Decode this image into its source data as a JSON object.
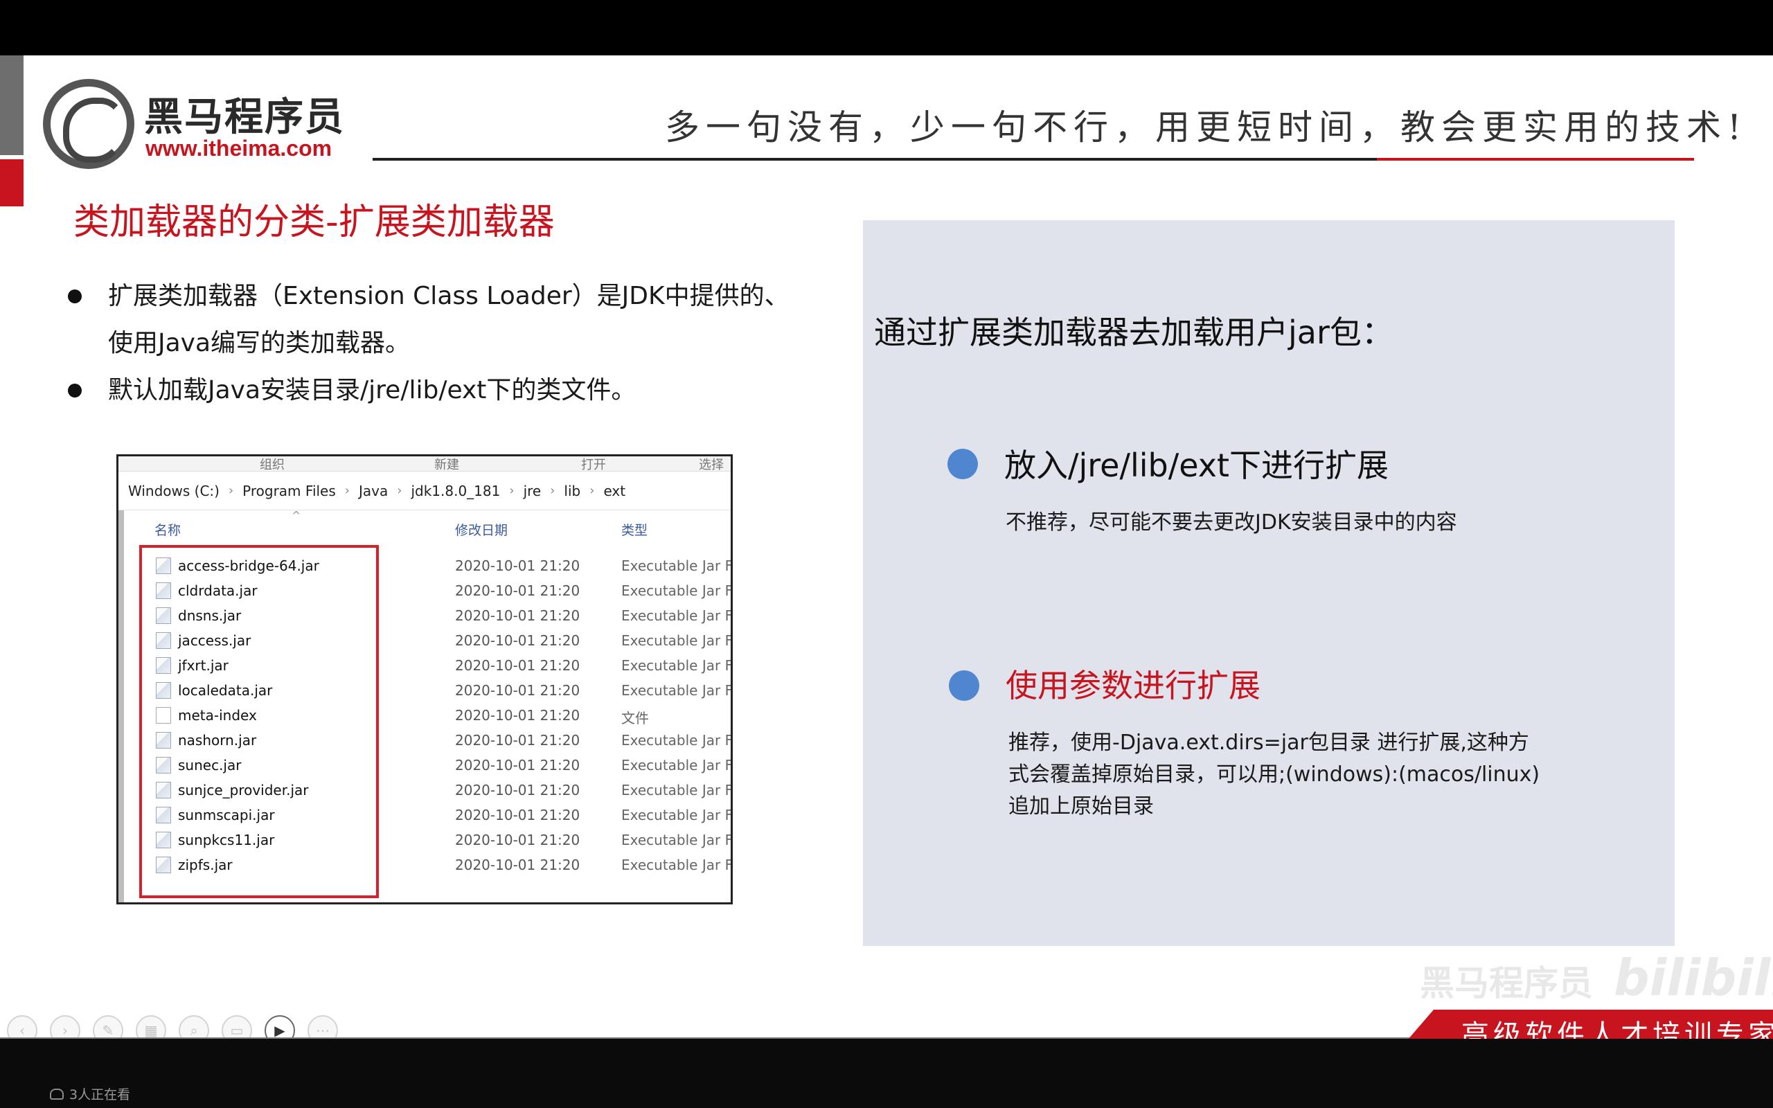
{
  "logo": {
    "name": "黑马程序员",
    "url": "www.itheima.com"
  },
  "slogan": "多一句没有，少一句不行，用更短时间，教会更实用的技术!",
  "slide_title": "类加载器的分类-扩展类加载器",
  "bullets": [
    {
      "line1": "扩展类加载器（Extension Class Loader）是JDK中提供的、",
      "line2": "使用Java编写的类加载器。"
    },
    {
      "line1": "默认加载Java安装目录/jre/lib/ext下的类文件。"
    }
  ],
  "explorer": {
    "ribbon": [
      "组织",
      "新建",
      "打开",
      "选择"
    ],
    "breadcrumb": [
      "Windows (C:)",
      "Program Files",
      "Java",
      "jdk1.8.0_181",
      "jre",
      "lib",
      "ext"
    ],
    "columns": {
      "name": "名称",
      "date": "修改日期",
      "type": "类型"
    },
    "files": [
      {
        "name": "access-bridge-64.jar",
        "date": "2020-10-01 21:20",
        "type": "Executable Jar Fi",
        "icon": "jar-file-icon"
      },
      {
        "name": "cldrdata.jar",
        "date": "2020-10-01 21:20",
        "type": "Executable Jar Fi",
        "icon": "jar-file-icon"
      },
      {
        "name": "dnsns.jar",
        "date": "2020-10-01 21:20",
        "type": "Executable Jar Fi",
        "icon": "jar-file-icon"
      },
      {
        "name": "jaccess.jar",
        "date": "2020-10-01 21:20",
        "type": "Executable Jar Fi",
        "icon": "jar-file-icon"
      },
      {
        "name": "jfxrt.jar",
        "date": "2020-10-01 21:20",
        "type": "Executable Jar Fi",
        "icon": "jar-file-icon"
      },
      {
        "name": "localedata.jar",
        "date": "2020-10-01 21:20",
        "type": "Executable Jar Fi",
        "icon": "jar-file-icon"
      },
      {
        "name": "meta-index",
        "date": "2020-10-01 21:20",
        "type": "文件",
        "icon": "file-icon"
      },
      {
        "name": "nashorn.jar",
        "date": "2020-10-01 21:20",
        "type": "Executable Jar Fi",
        "icon": "jar-file-icon"
      },
      {
        "name": "sunec.jar",
        "date": "2020-10-01 21:20",
        "type": "Executable Jar Fi",
        "icon": "jar-file-icon"
      },
      {
        "name": "sunjce_provider.jar",
        "date": "2020-10-01 21:20",
        "type": "Executable Jar Fi",
        "icon": "jar-file-icon"
      },
      {
        "name": "sunmscapi.jar",
        "date": "2020-10-01 21:20",
        "type": "Executable Jar Fi",
        "icon": "jar-file-icon"
      },
      {
        "name": "sunpkcs11.jar",
        "date": "2020-10-01 21:20",
        "type": "Executable Jar Fi",
        "icon": "jar-file-icon"
      },
      {
        "name": "zipfs.jar",
        "date": "2020-10-01 21:20",
        "type": "Executable Jar Fi",
        "icon": "jar-file-icon"
      }
    ]
  },
  "panel": {
    "heading": "通过扩展类加载器去加载用户jar包：",
    "option1": {
      "title": "放入/jre/lib/ext下进行扩展",
      "desc": "不推荐，尽可能不要去更改JDK安装目录中的内容"
    },
    "option2": {
      "title": "使用参数进行扩展",
      "desc_lines": [
        "推荐，使用-Djava.ext.dirs=jar包目录 进行扩展,这种方",
        "式会覆盖掉原始目录，可以用;(windows):(macos/linux)",
        "追加上原始目录"
      ]
    }
  },
  "watermark": {
    "text": "黑马程序员",
    "brand": "bilibili"
  },
  "footer_tag": "高级软件人才培训专家",
  "viewers": "3人正在看",
  "colors": {
    "brand_red": "#c8141e",
    "panel_bg": "#e0e3ec",
    "dot_blue": "#4f86cf",
    "highlight_box": "#d9202a"
  }
}
